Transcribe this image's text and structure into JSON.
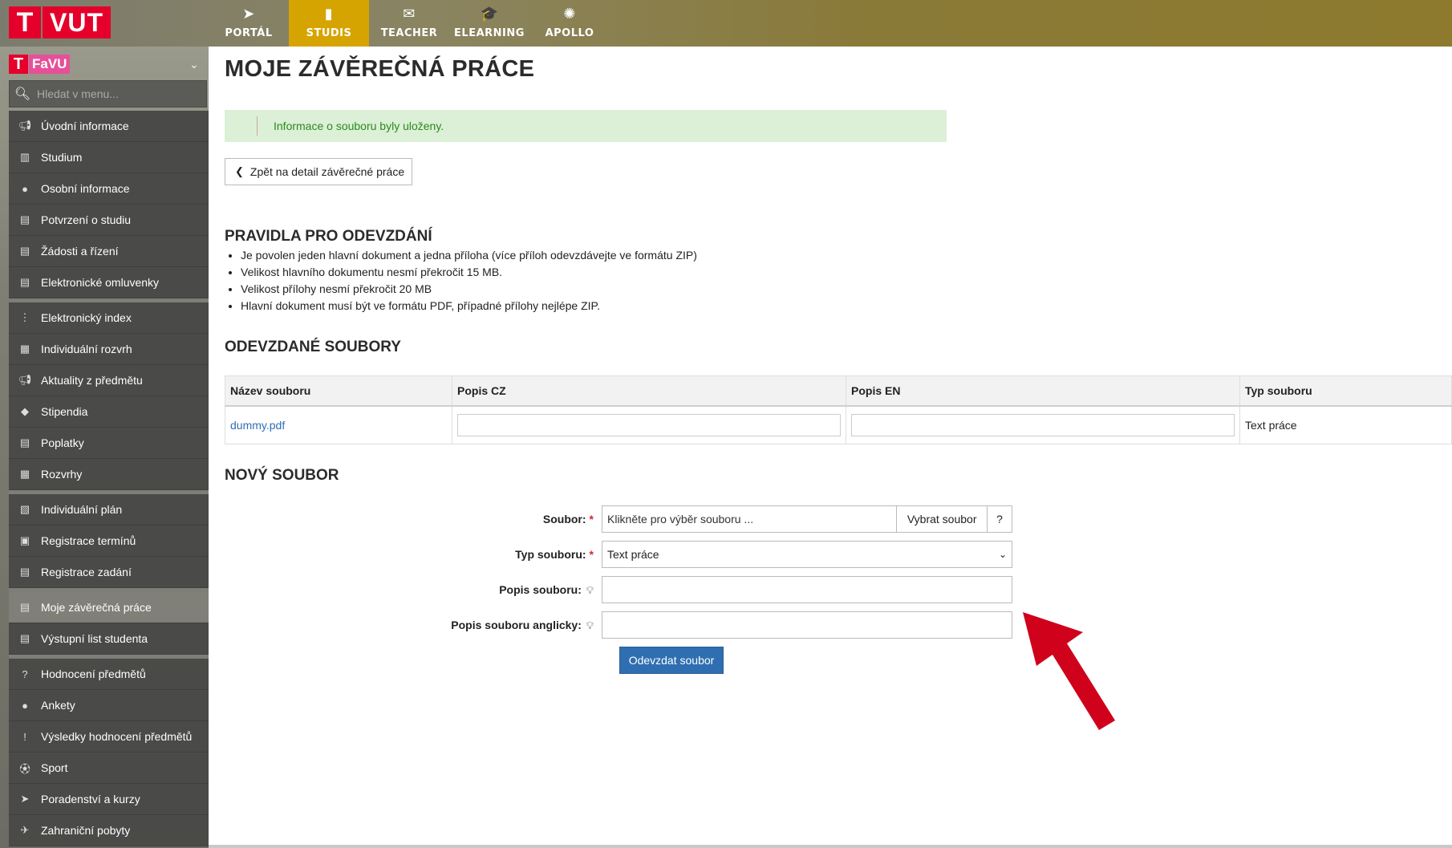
{
  "logo": {
    "t": "T",
    "text": "VUT"
  },
  "nav": [
    {
      "label": "PORTÁL",
      "icon": "➤"
    },
    {
      "label": "STUDIS",
      "icon": "▮"
    },
    {
      "label": "TEACHER",
      "icon": "✉"
    },
    {
      "label": "ELEARNING",
      "icon": "🎓"
    },
    {
      "label": "APOLLO",
      "icon": "✺"
    }
  ],
  "sidebar": {
    "faculty_t": "T",
    "faculty": "FaVU",
    "search_placeholder": "Hledat v menu...",
    "items": [
      {
        "label": "Úvodní informace",
        "icon": "megaphone-icon"
      },
      {
        "label": "Studium",
        "icon": "books-icon"
      },
      {
        "label": "Osobní informace",
        "icon": "user-icon"
      },
      {
        "label": "Potvrzení o studiu",
        "icon": "document-icon"
      },
      {
        "label": "Žádosti a řízení",
        "icon": "document-icon"
      },
      {
        "label": "Elektronické omluvenky",
        "icon": "document-icon"
      },
      {
        "label": "Elektronický index",
        "icon": "index-icon"
      },
      {
        "label": "Individuální rozvrh",
        "icon": "calendar-icon"
      },
      {
        "label": "Aktuality z předmětu",
        "icon": "megaphone-icon"
      },
      {
        "label": "Stipendia",
        "icon": "piggy-icon"
      },
      {
        "label": "Poplatky",
        "icon": "document-icon"
      },
      {
        "label": "Rozvrhy",
        "icon": "calendar-icon"
      },
      {
        "label": "Individuální plán",
        "icon": "plan-icon"
      },
      {
        "label": "Registrace termínů",
        "icon": "clipboard-icon"
      },
      {
        "label": "Registrace zadání",
        "icon": "document-icon"
      },
      {
        "label": "Moje závěrečná práce",
        "icon": "document-icon"
      },
      {
        "label": "Výstupní list studenta",
        "icon": "document-icon"
      },
      {
        "label": "Hodnocení předmětů",
        "icon": "question-icon"
      },
      {
        "label": "Ankety",
        "icon": "chat-icon"
      },
      {
        "label": "Výsledky hodnocení předmětů",
        "icon": "alert-icon"
      },
      {
        "label": "Sport",
        "icon": "ball-icon"
      },
      {
        "label": "Poradenství a kurzy",
        "icon": "arrow-icon"
      },
      {
        "label": "Zahraniční pobyty",
        "icon": "plane-icon"
      }
    ]
  },
  "page": {
    "title": "MOJE ZÁVĚREČNÁ PRÁCE",
    "flash": "Informace o souboru byly uloženy.",
    "back": "Zpět na detail závěrečné práce",
    "rules_heading": "PRAVIDLA PRO ODEVZDÁNÍ",
    "rules": [
      "Je povolen jeden hlavní dokument a jedna příloha (více příloh odevzdávejte ve formátu ZIP)",
      "Velikost hlavního dokumentu nesmí překročit 15 MB.",
      "Velikost přílohy nesmí překročit 20 MB",
      "Hlavní dokument musí být ve formátu PDF, případné přílohy nejlépe ZIP."
    ],
    "files_heading": "ODEVZDANÉ SOUBORY",
    "files_columns": [
      "Název souboru",
      "Popis CZ",
      "Popis EN",
      "Typ souboru"
    ],
    "files_rows": [
      {
        "name": "dummy.pdf",
        "type": "Text práce"
      }
    ],
    "new_heading": "NOVÝ SOUBOR",
    "form": {
      "file_label": "Soubor:",
      "file_placeholder": "Klikněte pro výběr souboru ...",
      "file_button": "Vybrat soubor",
      "file_help": "?",
      "type_label": "Typ souboru:",
      "type_value": "Text práce",
      "desc_label": "Popis souboru:",
      "desc_en_label": "Popis souboru anglicky:",
      "required_mark": "*",
      "submit": "Odevzdat soubor"
    }
  },
  "colors": {
    "accent": "#d6a400",
    "brand": "#e4002b",
    "primary": "#2f6fb1",
    "arrow": "#d0021b"
  }
}
